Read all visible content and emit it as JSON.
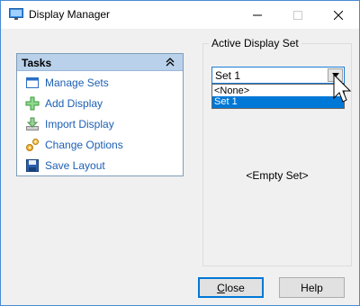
{
  "window": {
    "title": "Display Manager",
    "icon": "monitor-icon",
    "controls": {
      "minimize": "minimize-icon",
      "maximize": "maximize-icon",
      "close": "close-icon"
    }
  },
  "tasks": {
    "title": "Tasks",
    "collapse_icon": "double-chevron-up-icon",
    "items": [
      {
        "label": "Manage Sets",
        "icon": "window-icon"
      },
      {
        "label": "Add Display",
        "icon": "plus-icon"
      },
      {
        "label": "Import Display",
        "icon": "import-icon"
      },
      {
        "label": "Change Options",
        "icon": "gears-icon"
      },
      {
        "label": "Save Layout",
        "icon": "floppy-icon"
      }
    ]
  },
  "active_display_set": {
    "label": "Active Display Set",
    "selected": "Set 1",
    "options": [
      "<None>",
      "Set 1"
    ],
    "highlighted_option": "Set 1",
    "empty_text": "<Empty Set>"
  },
  "buttons": {
    "close_first": "C",
    "close_rest": "lose",
    "help": "Help"
  },
  "colors": {
    "accent": "#0078d7",
    "link": "#1c5fb3",
    "tasks_header": "#b9d1ea"
  }
}
